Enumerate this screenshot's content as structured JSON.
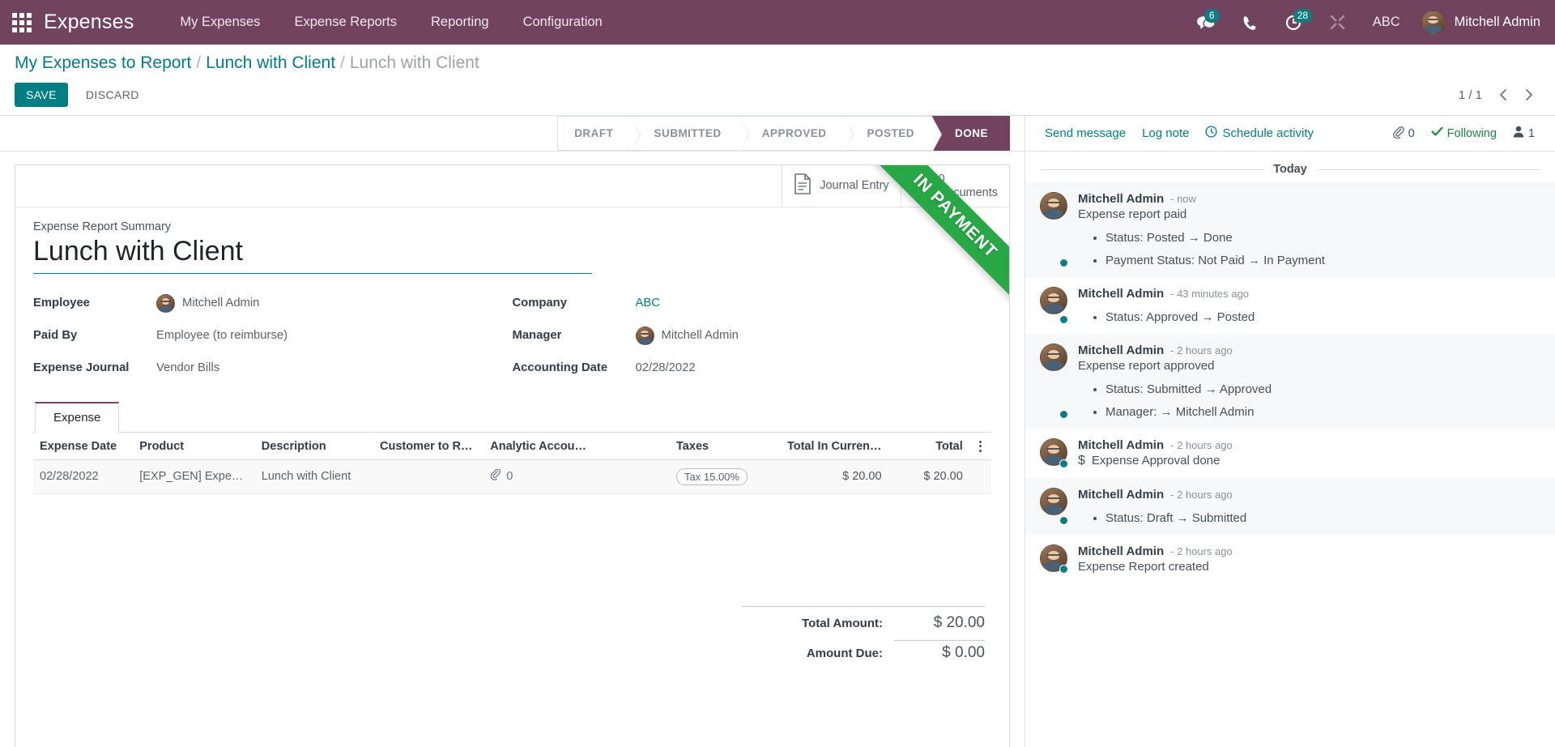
{
  "navbar": {
    "apps_icon": "apps-grid-icon",
    "brand": "Expenses",
    "menu": [
      "My Expenses",
      "Expense Reports",
      "Reporting",
      "Configuration"
    ],
    "messages_icon": "messages-icon",
    "messages_count": "6",
    "phone_icon": "phone-icon",
    "activity_icon": "activity-clock-icon",
    "activity_count": "28",
    "tools_icon": "tools-icon",
    "company": "ABC",
    "user": "Mitchell Admin",
    "avatar_icon": "user-avatar",
    "accent_color": "#71435f",
    "badge_color": "#0d7d82"
  },
  "control_panel": {
    "breadcrumb": {
      "root": "My Expenses to Report",
      "parent": "Lunch with Client",
      "current": "Lunch with Client",
      "separator": "/"
    },
    "save_label": "SAVE",
    "discard_label": "DISCARD",
    "pager": {
      "counter": "1 / 1",
      "prev_icon": "chevron-left-icon",
      "next_icon": "chevron-right-icon"
    }
  },
  "statusbar": {
    "stages": [
      "DRAFT",
      "SUBMITTED",
      "APPROVED",
      "POSTED",
      "DONE"
    ],
    "active": "DONE"
  },
  "form": {
    "smart_buttons": [
      {
        "icon": "journal-entry-icon",
        "value": "",
        "label": "Journal Entry"
      },
      {
        "icon": "documents-icon",
        "value": "0",
        "label": "Documents"
      }
    ],
    "ribbon": {
      "text": "IN PAYMENT",
      "color": "#28a745"
    },
    "title_label": "Expense Report Summary",
    "title": "Lunch with Client",
    "fields_left": [
      {
        "label": "Employee",
        "value": "Mitchell Admin",
        "avatar": true,
        "link": false
      },
      {
        "label": "Paid By",
        "value": "Employee (to reimburse)",
        "avatar": false,
        "link": false
      },
      {
        "label": "Expense Journal",
        "value": "Vendor Bills",
        "avatar": false,
        "link": false
      }
    ],
    "fields_right": [
      {
        "label": "Company",
        "value": "ABC",
        "avatar": false,
        "link": true
      },
      {
        "label": "Manager",
        "value": "Mitchell Admin",
        "avatar": true,
        "link": false
      },
      {
        "label": "Accounting Date",
        "value": "02/28/2022",
        "avatar": false,
        "link": false
      }
    ],
    "notebook": {
      "tabs": [
        "Expense"
      ],
      "active_tab": "Expense",
      "columns": [
        "Expense Date",
        "Product",
        "Description",
        "Customer to R…",
        "Analytic Accou…",
        "Taxes",
        "Total In Curren…",
        "Total"
      ],
      "options_icon": "column-options-icon",
      "rows": [
        {
          "expense_date": "02/28/2022",
          "product": "[EXP_GEN] Expe…",
          "description": "Lunch with Client",
          "customer_to_reinvoice": "",
          "analytic_account": "",
          "attachment_icon": "paperclip-icon",
          "attachment_count": "0",
          "taxes": "Tax 15.00%",
          "total_in_currency": "$ 20.00",
          "total": "$ 20.00"
        }
      ]
    },
    "totals": [
      {
        "label": "Total Amount:",
        "value": "$ 20.00"
      },
      {
        "label": "Amount Due:",
        "value": "$ 0.00"
      }
    ]
  },
  "chatter": {
    "send_message": "Send message",
    "log_note": "Log note",
    "schedule_activity": "Schedule activity",
    "schedule_icon": "clock-icon",
    "attachment_icon": "paperclip-icon",
    "attachment_count": "0",
    "follow_icon": "check-icon",
    "follow_label": "Following",
    "followers_icon": "user-icon",
    "followers_count": "1",
    "day_separator": "Today",
    "messages": [
      {
        "author": "Mitchell Admin",
        "time": "- now",
        "text": "Expense report paid",
        "bullets": [
          "Status: Posted → Done",
          "Payment Status: Not Paid → In Payment"
        ],
        "dollar": false
      },
      {
        "author": "Mitchell Admin",
        "time": "- 43 minutes ago",
        "text": "",
        "bullets": [
          "Status: Approved → Posted"
        ],
        "dollar": false
      },
      {
        "author": "Mitchell Admin",
        "time": "- 2 hours ago",
        "text": "Expense report approved",
        "bullets": [
          "Status: Submitted → Approved",
          "Manager: → Mitchell Admin"
        ],
        "dollar": false
      },
      {
        "author": "Mitchell Admin",
        "time": "- 2 hours ago",
        "text": "Expense Approval done",
        "bullets": [],
        "dollar": true
      },
      {
        "author": "Mitchell Admin",
        "time": "- 2 hours ago",
        "text": "",
        "bullets": [
          "Status: Draft → Submitted"
        ],
        "dollar": false
      },
      {
        "author": "Mitchell Admin",
        "time": "- 2 hours ago",
        "text": "Expense Report created",
        "bullets": [],
        "dollar": false
      }
    ]
  }
}
